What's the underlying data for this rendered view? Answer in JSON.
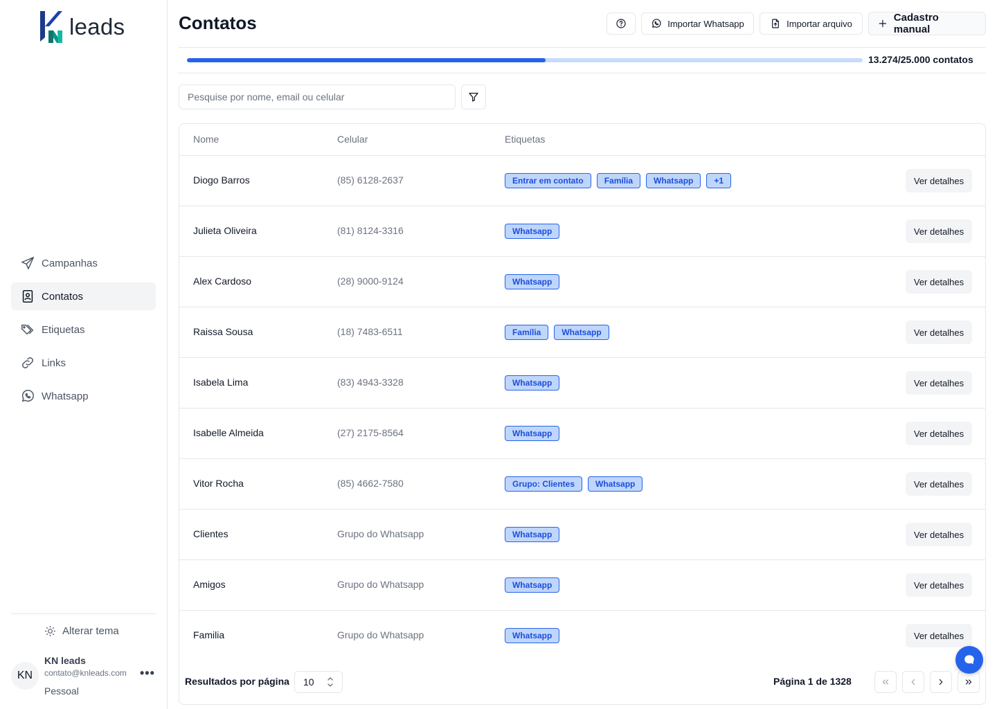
{
  "brand": {
    "logo_text": "leads"
  },
  "sidebar": {
    "items": [
      {
        "label": "Campanhas",
        "icon": "send-icon"
      },
      {
        "label": "Contatos",
        "icon": "contact-book-icon",
        "active": true
      },
      {
        "label": "Etiquetas",
        "icon": "tags-icon"
      },
      {
        "label": "Links",
        "icon": "link-icon"
      },
      {
        "label": "Whatsapp",
        "icon": "whatsapp-icon"
      }
    ],
    "theme_label": "Alterar tema",
    "user": {
      "initials": "KN",
      "name": "KN leads",
      "email": "contato@knleads.com",
      "plan": "Pessoal"
    }
  },
  "header": {
    "title": "Contatos",
    "import_whatsapp": "Importar Whatsapp",
    "import_file": "Importar arquivo",
    "manual": "Cadastro manual"
  },
  "usage": {
    "label": "13.274/25.000 contatos",
    "used": 13274,
    "total": 25000
  },
  "search": {
    "placeholder": "Pesquise por nome, email ou celular"
  },
  "table": {
    "columns": [
      "Nome",
      "Celular",
      "Etiquetas"
    ],
    "detail_label": "Ver detalhes",
    "rows": [
      {
        "name": "Diogo Barros",
        "phone": "(85) 6128-2637",
        "tags": [
          "Entrar em contato",
          "Família",
          "Whatsapp",
          "+1"
        ]
      },
      {
        "name": "Julieta Oliveira",
        "phone": "(81) 8124-3316",
        "tags": [
          "Whatsapp"
        ]
      },
      {
        "name": "Alex Cardoso",
        "phone": "(28) 9000-9124",
        "tags": [
          "Whatsapp"
        ]
      },
      {
        "name": "Raissa Sousa",
        "phone": "(18) 7483-6511",
        "tags": [
          "Família",
          "Whatsapp"
        ]
      },
      {
        "name": "Isabela Lima",
        "phone": "(83) 4943-3328",
        "tags": [
          "Whatsapp"
        ]
      },
      {
        "name": "Isabelle Almeida",
        "phone": "(27) 2175-8564",
        "tags": [
          "Whatsapp"
        ]
      },
      {
        "name": "Vitor Rocha",
        "phone": "(85) 4662-7580",
        "tags": [
          "Grupo: Clientes",
          "Whatsapp"
        ]
      },
      {
        "name": "Clientes",
        "phone": "Grupo do Whatsapp",
        "tags": [
          "Whatsapp"
        ]
      },
      {
        "name": "Amigos",
        "phone": "Grupo do Whatsapp",
        "tags": [
          "Whatsapp"
        ]
      },
      {
        "name": "Familia",
        "phone": "Grupo do Whatsapp",
        "tags": [
          "Whatsapp"
        ]
      }
    ]
  },
  "pagination": {
    "per_page_label": "Resultados por página",
    "per_page_value": "10",
    "page_info": "Página 1 de 1328"
  },
  "colors": {
    "accent": "#2563eb",
    "tag_bg": "#bfd6fb",
    "progress_track": "#c7dbfa"
  }
}
